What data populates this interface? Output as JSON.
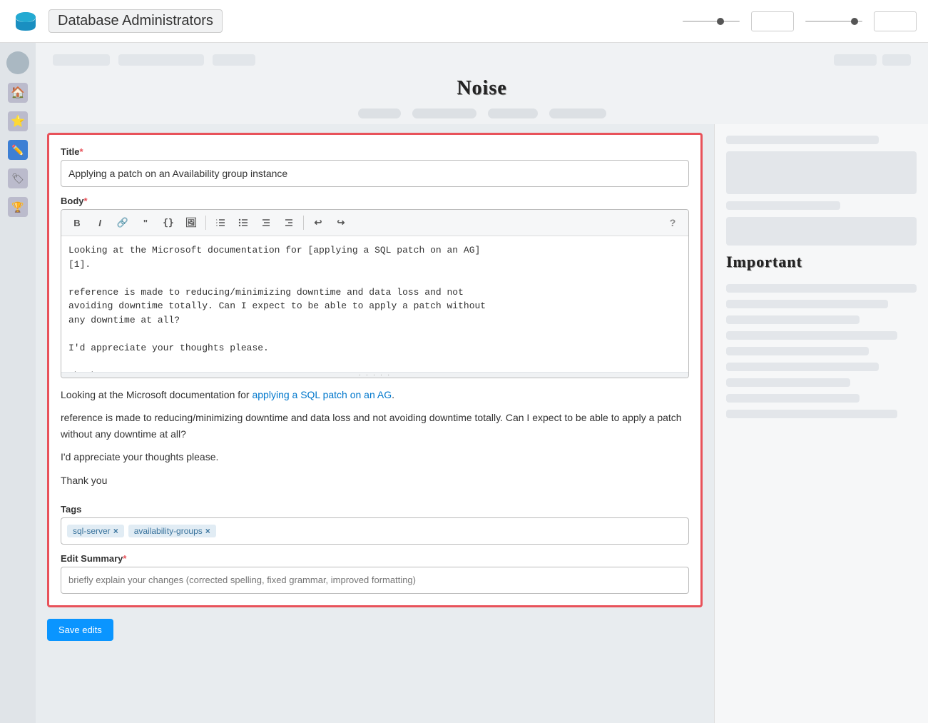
{
  "header": {
    "title": "Database Administrators",
    "logo_alt": "Database Administrators Logo"
  },
  "top_section": {
    "noise_title": "Noise"
  },
  "right_sidebar": {
    "important_title": "Important"
  },
  "form": {
    "title_label": "Title",
    "title_required": true,
    "title_value": "Applying a patch on an Availability group instance",
    "body_label": "Body",
    "body_required": true,
    "editor_content": "Looking at the Microsoft documentation for [applying a SQL patch on an AG]\n[1].\n\nreference is made to reducing/minimizing downtime and data loss and not\navoiding downtime totally. Can I expect to be able to apply a patch without\nany downtime at all?\n\nI'd appreciate your thoughts please.\n\nThank you",
    "preview_text_1": "Looking at the Microsoft documentation for",
    "preview_link_text": "applying a SQL patch on an AG",
    "preview_link_href": "#",
    "preview_text_1_end": ".",
    "preview_text_2": "reference is made to reducing/minimizing downtime and data loss and not avoiding downtime totally. Can I expect to be able to apply a patch without any downtime at all?",
    "preview_text_3": "I'd appreciate your thoughts please.",
    "preview_text_4": "Thank you",
    "tags_label": "Tags",
    "tags": [
      {
        "text": "sql-server",
        "id": "tag-sql-server"
      },
      {
        "text": "availability-groups",
        "id": "tag-availability-groups"
      }
    ],
    "edit_summary_label": "Edit Summary",
    "edit_summary_required": true,
    "edit_summary_placeholder": "briefly explain your changes (corrected spelling, fixed grammar, improved formatting)",
    "toolbar": {
      "bold": "B",
      "italic": "I",
      "link": "🔗",
      "blockquote": "❝",
      "code": "{}",
      "image": "🖼",
      "ol": "ol",
      "ul": "ul",
      "indent_left": "⇤",
      "indent_right": "⇥",
      "undo": "↩",
      "redo": "↪",
      "help": "?"
    },
    "submit_label": "Save edits"
  },
  "colors": {
    "brand_blue": "#0a95ff",
    "error_red": "#e8525a",
    "tag_bg": "#e1ecf4",
    "tag_color": "#39739d",
    "link_color": "#0077cc"
  }
}
